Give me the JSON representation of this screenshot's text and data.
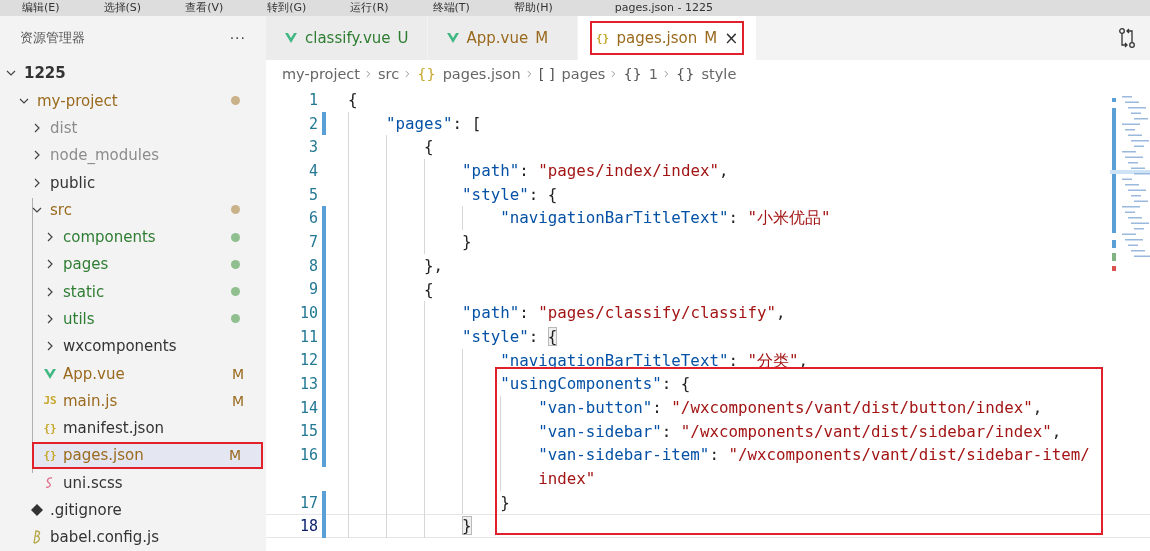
{
  "menu_bar": {
    "items": [
      "编辑(E)",
      "选择(S)",
      "查看(V)",
      "转到(G)",
      "运行(R)",
      "终端(T)",
      "帮助(H)"
    ],
    "title": "pages.json - 1225"
  },
  "sidebar": {
    "title": "资源管理器",
    "more": "···",
    "tree": [
      {
        "label": "1225",
        "kind": "folder",
        "expanded": true,
        "bold": true,
        "color": "#333333",
        "children": [
          {
            "label": "my-project",
            "kind": "folder",
            "expanded": true,
            "color": "#9a6a1e",
            "dot": {
              "color": "#c9b18a"
            },
            "children": [
              {
                "label": "dist",
                "kind": "folder",
                "expanded": false,
                "color": "#8c8c8c"
              },
              {
                "label": "node_modules",
                "kind": "folder",
                "expanded": false,
                "color": "#8c8c8c"
              },
              {
                "label": "public",
                "kind": "folder",
                "expanded": false,
                "color": "#333333"
              },
              {
                "label": "src",
                "kind": "folder",
                "expanded": true,
                "color": "#9a6a1e",
                "dot": {
                  "color": "#c9b18a"
                },
                "children": [
                  {
                    "label": "components",
                    "kind": "folder",
                    "expanded": false,
                    "color": "#2e7d32",
                    "dot": {
                      "color": "#8fbf8f"
                    }
                  },
                  {
                    "label": "pages",
                    "kind": "folder",
                    "expanded": false,
                    "color": "#2e7d32",
                    "dot": {
                      "color": "#8fbf8f"
                    }
                  },
                  {
                    "label": "static",
                    "kind": "folder",
                    "expanded": false,
                    "color": "#2e7d32",
                    "dot": {
                      "color": "#8fbf8f"
                    }
                  },
                  {
                    "label": "utils",
                    "kind": "folder",
                    "expanded": false,
                    "color": "#2e7d32",
                    "dot": {
                      "color": "#8fbf8f"
                    }
                  },
                  {
                    "label": "wxcomponents",
                    "kind": "folder",
                    "expanded": false,
                    "color": "#333333"
                  },
                  {
                    "label": "App.vue",
                    "kind": "vue",
                    "color": "#9a6a1e",
                    "badge": "M"
                  },
                  {
                    "label": "main.js",
                    "kind": "js",
                    "icon_text": "JS",
                    "color": "#9a6a1e",
                    "badge": "M"
                  },
                  {
                    "label": "manifest.json",
                    "kind": "json",
                    "icon_text": "{}",
                    "color": "#333333"
                  },
                  {
                    "label": "pages.json",
                    "kind": "json",
                    "icon_text": "{}",
                    "color": "#9a6a1e",
                    "badge": "M",
                    "selected": true,
                    "highlighted": true
                  },
                  {
                    "label": "uni.scss",
                    "kind": "scss",
                    "color": "#333333"
                  }
                ]
              },
              {
                "label": ".gitignore",
                "kind": "git",
                "color": "#333333"
              },
              {
                "label": "babel.config.js",
                "kind": "babel",
                "color": "#333333"
              }
            ]
          }
        ]
      }
    ]
  },
  "tabs": [
    {
      "label": "classify.vue",
      "kind": "vue",
      "badge": "U",
      "color": "#2e7d32",
      "selected": false,
      "highlighted": false
    },
    {
      "label": "App.vue",
      "kind": "vue",
      "badge": "M",
      "color": "#9a6a1e",
      "selected": false,
      "highlighted": false
    },
    {
      "label": "pages.json",
      "kind": "json",
      "icon_text": "{}",
      "badge": "M",
      "color": "#9a6a1e",
      "selected": true,
      "highlighted": true,
      "close": "×"
    }
  ],
  "breadcrumb": [
    {
      "label": "my-project"
    },
    {
      "label": "src"
    },
    {
      "icon_text": "{}",
      "label": "pages.json",
      "kind": "file"
    },
    {
      "icon_text": "[ ]",
      "label": "pages"
    },
    {
      "icon_text": "{}",
      "label": "1"
    },
    {
      "icon_text": "{}",
      "label": "style"
    }
  ],
  "editor": {
    "lines": [
      {
        "number": "1",
        "modified": false,
        "tokens": [
          {
            "kind": "punct",
            "text": "{"
          }
        ],
        "children": [
          {
            "number": "2",
            "modified": true,
            "tokens": [
              {
                "kind": "key",
                "text": "\"pages\""
              },
              {
                "kind": "punct",
                "text": ": ["
              }
            ],
            "children": [
              {
                "number": "3",
                "modified": false,
                "tokens": [
                  {
                    "kind": "punct",
                    "text": "{"
                  }
                ],
                "children": [
                  {
                    "number": "4",
                    "modified": false,
                    "tokens": [
                      {
                        "kind": "key",
                        "text": "\"path\""
                      },
                      {
                        "kind": "punct",
                        "text": ": "
                      },
                      {
                        "kind": "string",
                        "text": "\"pages/index/index\""
                      },
                      {
                        "kind": "punct",
                        "text": ","
                      }
                    ]
                  },
                  {
                    "number": "5",
                    "modified": false,
                    "tokens": [
                      {
                        "kind": "key",
                        "text": "\"style\""
                      },
                      {
                        "kind": "punct",
                        "text": ": {"
                      }
                    ],
                    "children": [
                      {
                        "number": "6",
                        "modified": true,
                        "tokens": [
                          {
                            "kind": "key",
                            "text": "\"navigationBarTitleText\""
                          },
                          {
                            "kind": "punct",
                            "text": ": "
                          },
                          {
                            "kind": "string",
                            "text": "\"小米优品\""
                          }
                        ]
                      }
                    ]
                  },
                  {
                    "number": "7",
                    "modified": true,
                    "tokens": [
                      {
                        "kind": "punct",
                        "text": "}"
                      }
                    ]
                  }
                ]
              },
              {
                "number": "8",
                "modified": true,
                "tokens": [
                  {
                    "kind": "punct",
                    "text": "},"
                  }
                ]
              },
              {
                "number": "9",
                "modified": true,
                "tokens": [
                  {
                    "kind": "punct",
                    "text": "{"
                  }
                ],
                "children": [
                  {
                    "number": "10",
                    "modified": true,
                    "tokens": [
                      {
                        "kind": "key",
                        "text": "\"path\""
                      },
                      {
                        "kind": "punct",
                        "text": ": "
                      },
                      {
                        "kind": "string",
                        "text": "\"pages/classify/classify\""
                      },
                      {
                        "kind": "punct",
                        "text": ","
                      }
                    ]
                  },
                  {
                    "number": "11",
                    "modified": true,
                    "tokens": [
                      {
                        "kind": "key",
                        "text": "\"style\""
                      },
                      {
                        "kind": "punct",
                        "text": ": "
                      },
                      {
                        "kind": "punct",
                        "text": "{",
                        "matched": true
                      }
                    ],
                    "children": [
                      {
                        "number": "12",
                        "modified": true,
                        "tokens": [
                          {
                            "kind": "key",
                            "text": "\"navigationBarTitleText\""
                          },
                          {
                            "kind": "punct",
                            "text": ": "
                          },
                          {
                            "kind": "string",
                            "text": "\"分类\""
                          },
                          {
                            "kind": "punct",
                            "text": ","
                          }
                        ]
                      },
                      {
                        "number": "13",
                        "modified": true,
                        "boxed": true,
                        "tokens": [
                          {
                            "kind": "key",
                            "text": "\"usingComponents\""
                          },
                          {
                            "kind": "punct",
                            "text": ": {"
                          }
                        ],
                        "children": [
                          {
                            "number": "14",
                            "modified": true,
                            "boxed": true,
                            "tokens": [
                              {
                                "kind": "key",
                                "text": "\"van-button\""
                              },
                              {
                                "kind": "punct",
                                "text": ": "
                              },
                              {
                                "kind": "string",
                                "text": "\"/wxcomponents/vant/dist/button/index\""
                              },
                              {
                                "kind": "punct",
                                "text": ","
                              }
                            ]
                          },
                          {
                            "number": "15",
                            "modified": true,
                            "boxed": true,
                            "tokens": [
                              {
                                "kind": "key",
                                "text": "\"van-sidebar\""
                              },
                              {
                                "kind": "punct",
                                "text": ": "
                              },
                              {
                                "kind": "string",
                                "text": "\"/wxcomponents/vant/dist/sidebar/index\""
                              },
                              {
                                "kind": "punct",
                                "text": ","
                              }
                            ]
                          },
                          {
                            "number": "16",
                            "modified": true,
                            "boxed": true,
                            "tokens": [
                              {
                                "kind": "key",
                                "text": "\"van-sidebar-item\""
                              },
                              {
                                "kind": "punct",
                                "text": ": "
                              },
                              {
                                "kind": "string",
                                "text": "\"/wxcomponents/vant/dist/sidebar-item/"
                              }
                            ],
                            "continuation": [
                              {
                                "kind": "string",
                                "text": "index\""
                              }
                            ]
                          }
                        ]
                      },
                      {
                        "number": "17",
                        "modified": true,
                        "boxed": true,
                        "tokens": [
                          {
                            "kind": "punct",
                            "text": "}"
                          }
                        ]
                      }
                    ]
                  },
                  {
                    "number": "18",
                    "modified": true,
                    "current": true,
                    "tokens": [
                      {
                        "kind": "punct",
                        "text": "}",
                        "matched": true
                      }
                    ]
                  }
                ]
              }
            ]
          }
        ]
      }
    ]
  }
}
